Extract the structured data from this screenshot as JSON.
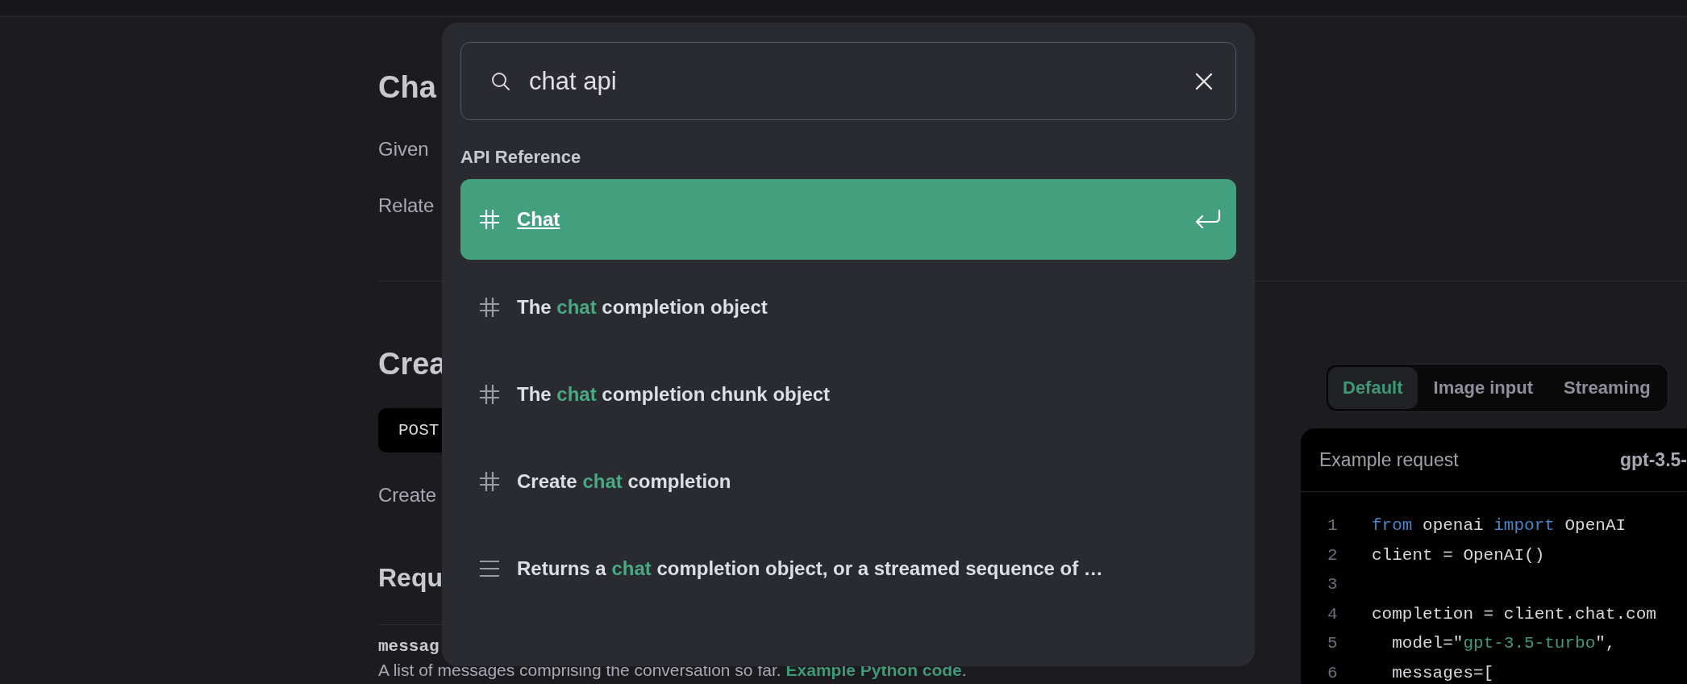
{
  "background_page": {
    "heading_1": "Cha",
    "text_1": "Given",
    "text_2": "Relate",
    "heading_2": "Crea",
    "method": "POST",
    "text_3": "Create",
    "heading_3": "Requ",
    "param_name": "messag",
    "param_description": "A list of messages comprising the conversation so far.",
    "param_link": "Example Python code",
    "param_end": "."
  },
  "code_panel": {
    "tabs": [
      {
        "label": "Default",
        "selected": true
      },
      {
        "label": "Image input",
        "selected": false
      },
      {
        "label": "Streaming",
        "selected": false
      }
    ],
    "header_title": "Example request",
    "model": "gpt-3.5-",
    "lines": [
      {
        "number": "1",
        "tokens": [
          {
            "text": "from",
            "kind": "keyword"
          },
          {
            "text": " openai ",
            "kind": "plain"
          },
          {
            "text": "import",
            "kind": "keyword"
          },
          {
            "text": " OpenAI",
            "kind": "plain"
          }
        ]
      },
      {
        "number": "2",
        "tokens": [
          {
            "text": "client = OpenAI()",
            "kind": "plain"
          }
        ]
      },
      {
        "number": "3"
      },
      {
        "number": "4",
        "tokens": [
          {
            "text": "completion = client.chat.com",
            "kind": "plain"
          }
        ]
      },
      {
        "number": "5",
        "tokens": [
          {
            "text": "  model=\"",
            "kind": "plain"
          },
          {
            "text": "gpt-3.5-turbo",
            "kind": "string"
          },
          {
            "text": "\",",
            "kind": "plain"
          }
        ]
      },
      {
        "number": "6",
        "tokens": [
          {
            "text": "  messages=[",
            "kind": "plain"
          }
        ]
      }
    ]
  },
  "search_dialog": {
    "search": {
      "value": "chat api"
    },
    "section_label": "API Reference",
    "results": [
      {
        "kind": "section",
        "selected": true,
        "parts": [
          {
            "text": "Chat"
          }
        ]
      },
      {
        "kind": "section",
        "selected": false,
        "parts": [
          {
            "text": "The ",
            "match": false
          },
          {
            "text": "chat",
            "match": true
          },
          {
            "text": " completion object",
            "match": false
          }
        ]
      },
      {
        "kind": "section",
        "selected": false,
        "parts": [
          {
            "text": "The ",
            "match": false
          },
          {
            "text": "chat",
            "match": true
          },
          {
            "text": " completion chunk object",
            "match": false
          }
        ]
      },
      {
        "kind": "section",
        "selected": false,
        "parts": [
          {
            "text": "Create ",
            "match": false
          },
          {
            "text": "chat",
            "match": true
          },
          {
            "text": " completion",
            "match": false
          }
        ]
      },
      {
        "kind": "text",
        "selected": false,
        "parts": [
          {
            "text": "Returns a ",
            "match": false
          },
          {
            "text": "chat",
            "match": true
          },
          {
            "text": " completion object, or a streamed sequence of …",
            "match": false
          }
        ]
      }
    ]
  }
}
